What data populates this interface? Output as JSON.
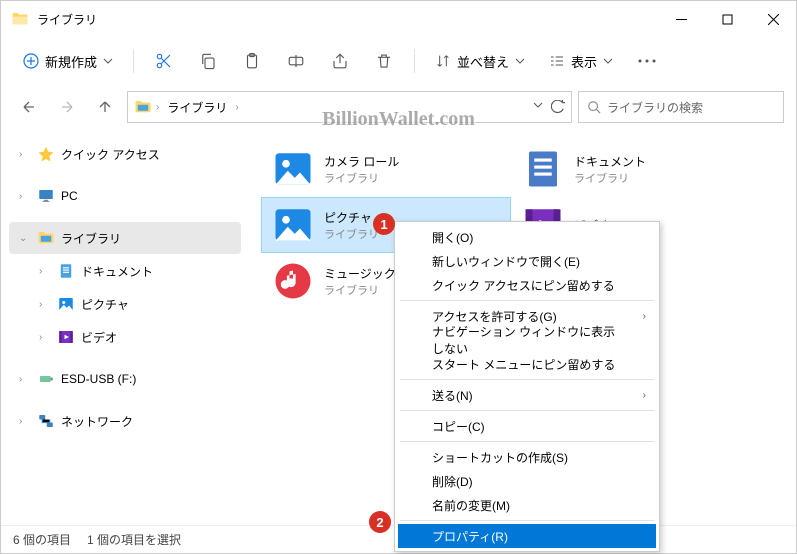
{
  "window": {
    "title": "ライブラリ"
  },
  "toolbar": {
    "new": "新規作成",
    "sort": "並べ替え",
    "view": "表示"
  },
  "path": {
    "segment": "ライブラリ"
  },
  "search": {
    "placeholder": "ライブラリの検索"
  },
  "tree": {
    "quickaccess": "クイック アクセス",
    "pc": "PC",
    "libraries": "ライブラリ",
    "documents": "ドキュメント",
    "pictures": "ピクチャ",
    "videos": "ビデオ",
    "esd": "ESD-USB (F:)",
    "network": "ネットワーク"
  },
  "items": {
    "cameraroll": {
      "name": "カメラ ロール",
      "sub": "ライブラリ"
    },
    "documents": {
      "name": "ドキュメント",
      "sub": "ライブラリ"
    },
    "pictures": {
      "name": "ピクチャ",
      "sub": "ライブラリ"
    },
    "videos": {
      "name": "ビデオ",
      "sub": ""
    },
    "music": {
      "name": "ミュージック",
      "sub": "ライブラリ"
    }
  },
  "context": {
    "open": "開く(O)",
    "newwindow": "新しいウィンドウで開く(E)",
    "pinquick": "クイック アクセスにピン留めする",
    "access": "アクセスを許可する(G)",
    "nonav": "ナビゲーション ウィンドウに表示しない",
    "pinstart": "スタート メニューにピン留めする",
    "sendto": "送る(N)",
    "copy": "コピー(C)",
    "shortcut": "ショートカットの作成(S)",
    "delete": "削除(D)",
    "rename": "名前の変更(M)",
    "properties": "プロパティ(R)"
  },
  "status": {
    "count": "6 個の項目",
    "selected": "1 個の項目を選択"
  },
  "watermark": "BillionWallet.com",
  "badges": {
    "b1": "1",
    "b2": "2"
  }
}
